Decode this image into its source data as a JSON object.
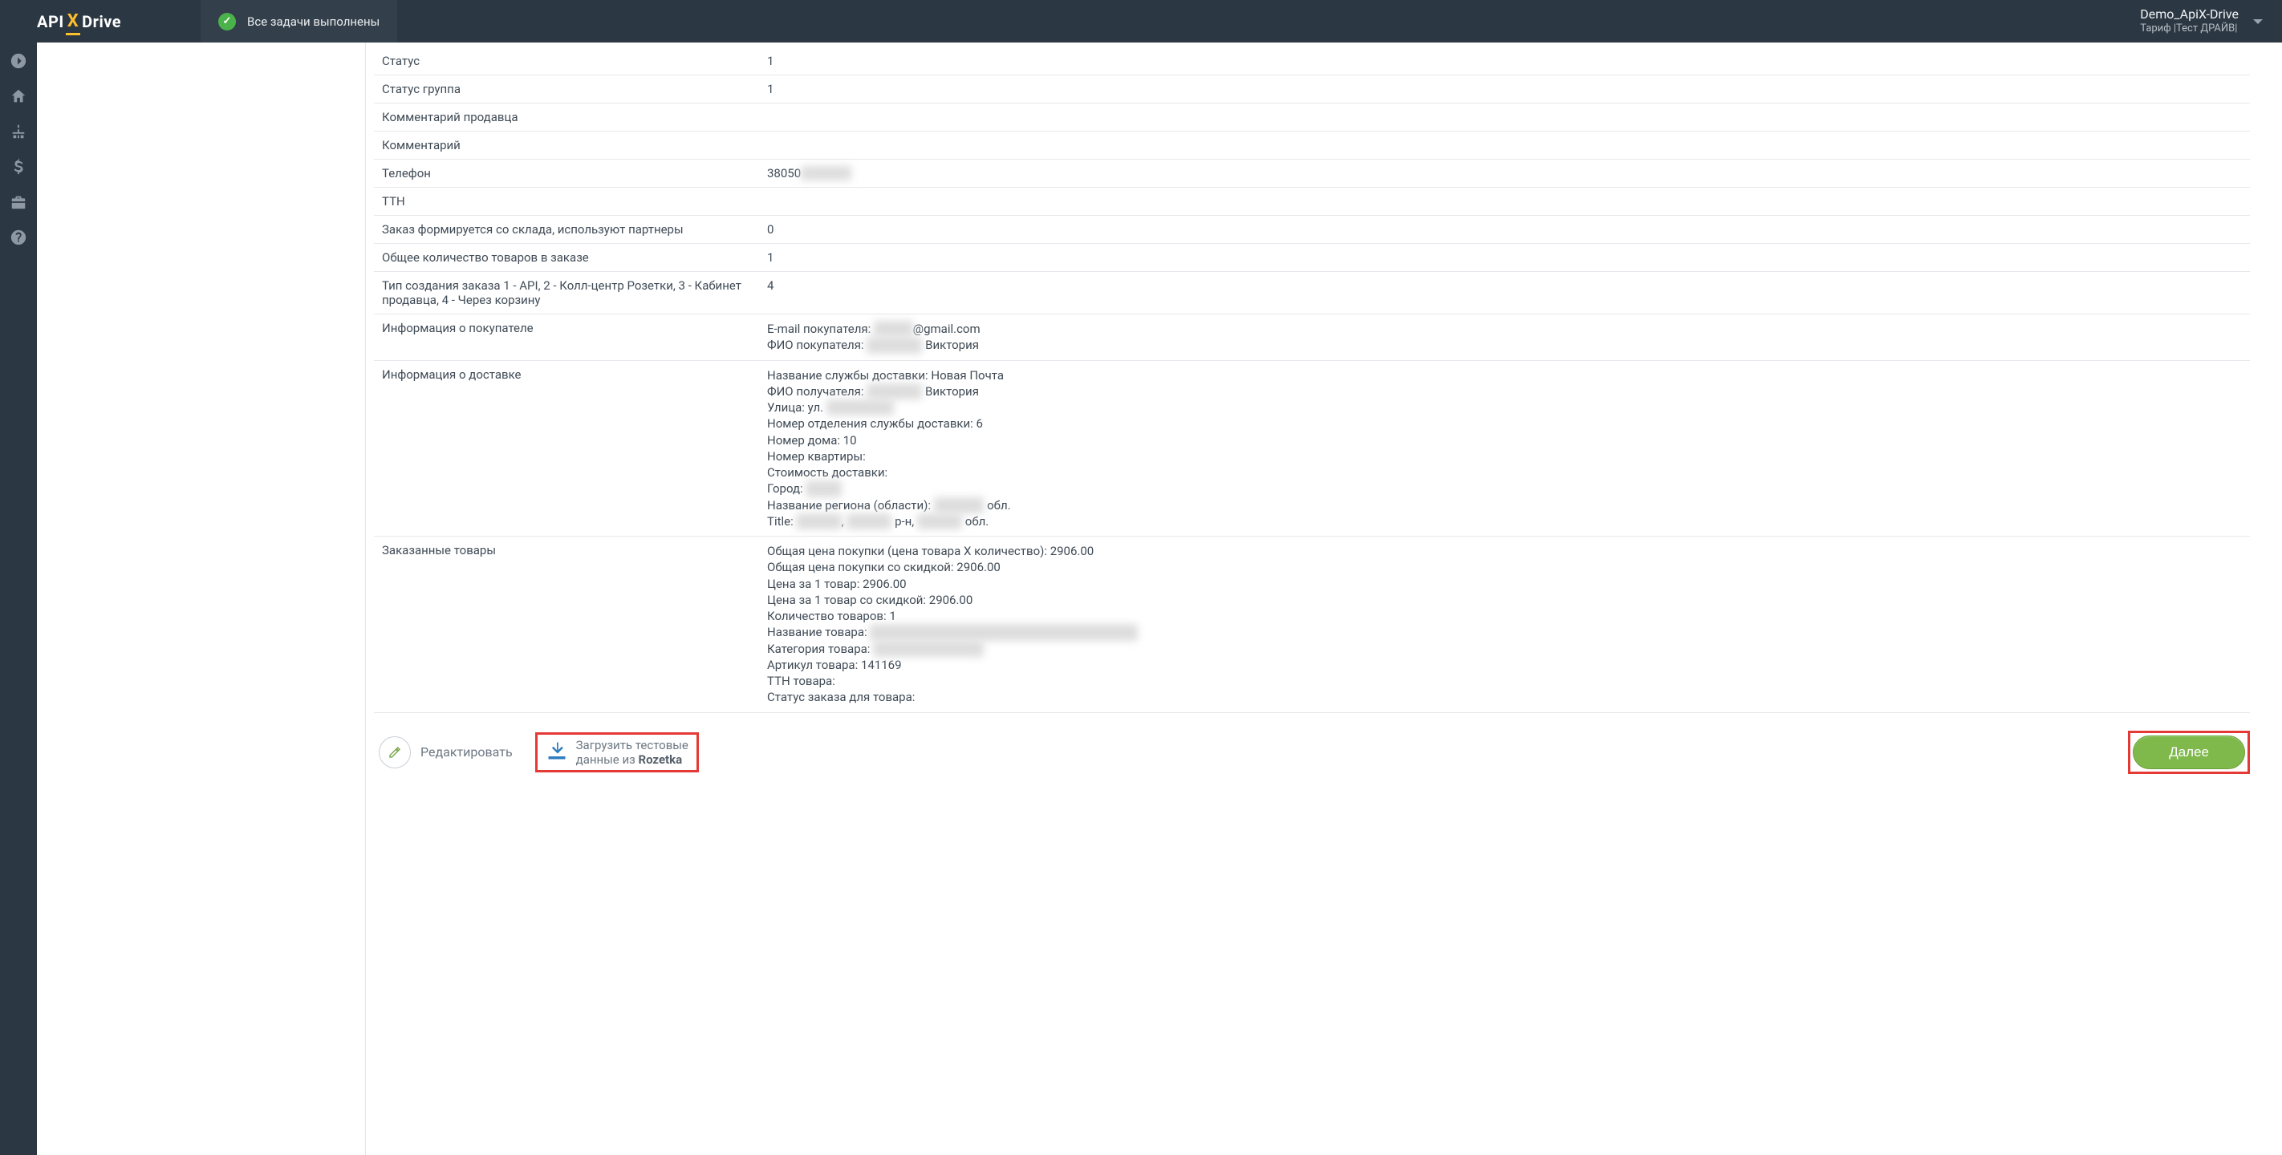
{
  "header": {
    "logo": {
      "api": "API",
      "drive": "Drive",
      "x": "X"
    },
    "status_label": "Все задачи выполнены",
    "account_name": "Demo_ApiX-Drive",
    "account_plan": "Тариф |Тест ДРАЙВ|"
  },
  "rows": [
    {
      "key": "Статус",
      "value_plain": "1"
    },
    {
      "key": "Статус группа",
      "value_plain": "1"
    },
    {
      "key": "Комментарий продавца",
      "value_plain": ""
    },
    {
      "key": "Комментарий",
      "value_plain": ""
    },
    {
      "key": "Телефон",
      "value_segments": [
        {
          "t": "38050"
        },
        {
          "t": "0000000",
          "blur": true
        }
      ]
    },
    {
      "key": "ТТН",
      "value_plain": ""
    },
    {
      "key": "Заказ формируется со склада, используют партнеры",
      "value_plain": "0"
    },
    {
      "key": "Общее количество товаров в заказе",
      "value_plain": "1"
    },
    {
      "key": "Тип создания заказа 1 - API, 2 - Колл-центр Розетки, 3 - Кабинет продавца, 4 - Через корзину",
      "value_plain": "4"
    },
    {
      "key": "Информация о покупателе",
      "value_lines": [
        [
          {
            "t": "E-mail покупателя: "
          },
          {
            "t": "xxxxxx",
            "blur": true
          },
          {
            "t": "@gmail.com"
          }
        ],
        [
          {
            "t": "ФИО покупателя: "
          },
          {
            "t": "Фамилия",
            "blur": true
          },
          {
            "t": " Виктория"
          }
        ]
      ]
    },
    {
      "key": "Информация о доставке",
      "value_lines": [
        [
          {
            "t": "Название службы доставки: Новая Почта"
          }
        ],
        [
          {
            "t": "ФИО получателя: "
          },
          {
            "t": "Фамилия",
            "blur": true
          },
          {
            "t": " Виктория"
          }
        ],
        [
          {
            "t": "Улица: ул. "
          },
          {
            "t": "Примерная",
            "blur": true
          }
        ],
        [
          {
            "t": "Номер отделения службы доставки: 6"
          }
        ],
        [
          {
            "t": "Номер дома: 10"
          }
        ],
        [
          {
            "t": "Номер квартиры:"
          }
        ],
        [
          {
            "t": "Стоимость доставки:"
          }
        ],
        [
          {
            "t": "Город: "
          },
          {
            "t": "Город",
            "blur": true
          }
        ],
        [
          {
            "t": "Название региона (области): "
          },
          {
            "t": "Область",
            "blur": true
          },
          {
            "t": " обл."
          }
        ],
        [
          {
            "t": "Title: "
          },
          {
            "t": "xxxxxxx",
            "blur": true
          },
          {
            "t": ", "
          },
          {
            "t": "xxxxxxx",
            "blur": true
          },
          {
            "t": " р-н, "
          },
          {
            "t": "xxxxxxx",
            "blur": true
          },
          {
            "t": " обл."
          }
        ]
      ]
    },
    {
      "key": "Заказанные товары",
      "value_lines": [
        [
          {
            "t": "Общая цена покупки (цена товара X количество): 2906.00"
          }
        ],
        [
          {
            "t": "Общая цена покупки со скидкой: 2906.00"
          }
        ],
        [
          {
            "t": "Цена за 1 товар: 2906.00"
          }
        ],
        [
          {
            "t": "Цена за 1 товар со скидкой: 2906.00"
          }
        ],
        [
          {
            "t": "Количество товаров: 1"
          }
        ],
        [
          {
            "t": "Название товара: "
          },
          {
            "t": "Серебряный браслет с подвеской 14750 линкс",
            "blur": true
          }
        ],
        [
          {
            "t": "Категория товара: "
          },
          {
            "t": "Женские браслеты",
            "blur": true
          }
        ],
        [
          {
            "t": "Артикул товара: 141169"
          }
        ],
        [
          {
            "t": "ТТН товара:"
          }
        ],
        [
          {
            "t": "Статус заказа для товара:"
          }
        ]
      ]
    }
  ],
  "actions": {
    "edit_label": "Редактировать",
    "load_line1": "Загрузить тестовые",
    "load_line2_prefix": "данные из ",
    "load_line2_source": "Rozetka",
    "next_label": "Далее"
  }
}
